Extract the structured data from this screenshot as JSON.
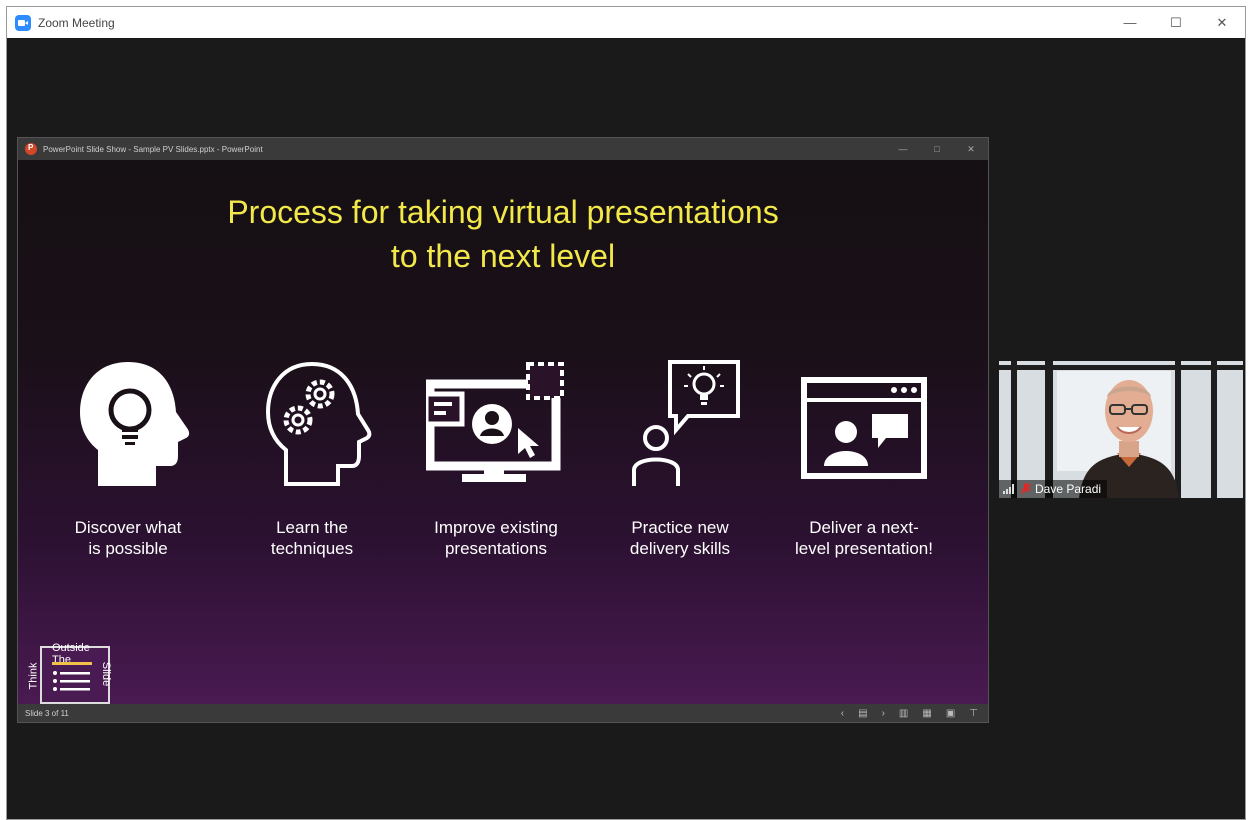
{
  "zoom": {
    "title": "Zoom Meeting",
    "controls": {
      "minimize": "—",
      "maximize": "☐",
      "close": "✕"
    }
  },
  "ppt": {
    "title": "PowerPoint Slide Show  -  Sample PV Slides.pptx  -  PowerPoint",
    "controls": {
      "minimize": "—",
      "maximize": "□",
      "close": "✕"
    },
    "status": {
      "slide_counter": "Slide 3 of 11"
    },
    "nav": {
      "prev": "‹",
      "notes": "▤",
      "next": "›",
      "normal_view": "▥",
      "slide_sorter": "▦",
      "reading_view": "▣",
      "slideshow": "⊤"
    }
  },
  "slide": {
    "title_line1": "Process for taking virtual presentations",
    "title_line2": "to the next level",
    "steps": [
      {
        "label_line1": "Discover what",
        "label_line2": "is possible",
        "icon": "head-lightbulb-icon"
      },
      {
        "label_line1": "Learn the",
        "label_line2": "techniques",
        "icon": "head-gears-icon"
      },
      {
        "label_line1": "Improve existing",
        "label_line2": "presentations",
        "icon": "monitor-presentation-icon"
      },
      {
        "label_line1": "Practice new",
        "label_line2": "delivery skills",
        "icon": "person-idea-icon"
      },
      {
        "label_line1": "Deliver a next-",
        "label_line2": "level presentation!",
        "icon": "video-call-icon"
      }
    ],
    "logo": {
      "word_think": "Think",
      "word_outside": "Outside The",
      "word_slide": "Slide"
    }
  },
  "participant": {
    "name": "Dave Paradi"
  },
  "colors": {
    "title_yellow": "#f2e84a",
    "zoom_blue": "#2d8cff",
    "slide_purple": "#4a1a52"
  }
}
